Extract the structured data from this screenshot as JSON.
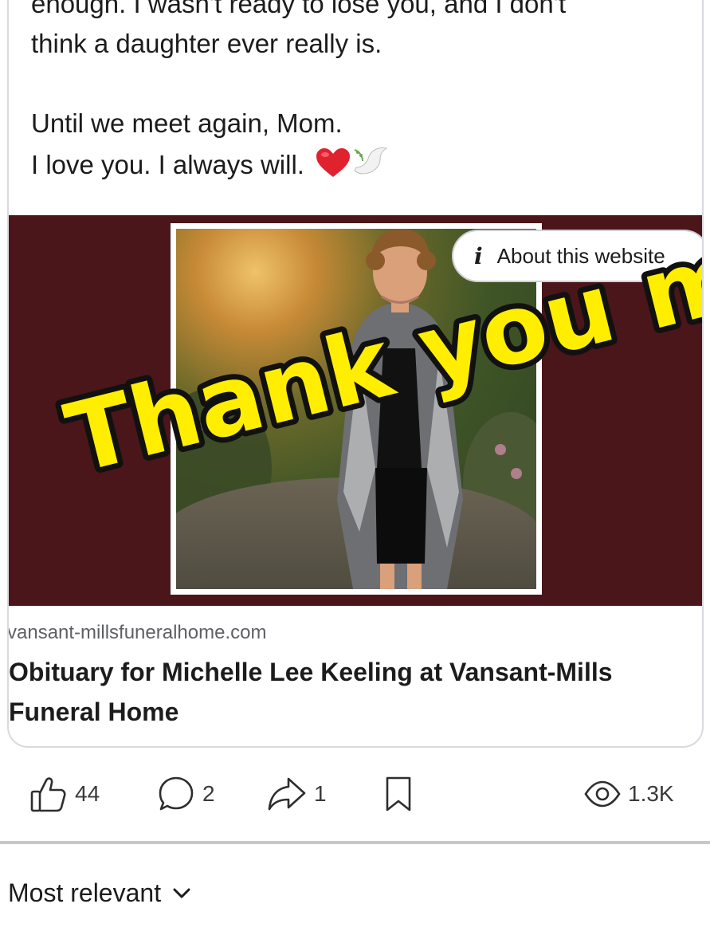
{
  "post": {
    "lines": [
      "enough. I wasn't ready to lose you, and I don't",
      "think a daughter ever really is.",
      "Until we meet again, Mom.",
      "I love you. I always will."
    ]
  },
  "media": {
    "about_label": "About this website",
    "overlay_text": "Thank you mom",
    "colors": {
      "backdrop": "#4a1619",
      "overlay_fill": "#ffee00",
      "overlay_stroke": "#111111"
    }
  },
  "link": {
    "domain": "vansant-millsfuneralhome.com",
    "title_lines": [
      "Obituary for Michelle Lee Keeling at Vansant-Mills",
      "Funeral Home"
    ]
  },
  "actions": {
    "likes": "44",
    "comments": "2",
    "shares": "1",
    "views": "1.3K",
    "icons": [
      "thumbs-up-icon",
      "comment-icon",
      "share-icon",
      "bookmark-icon",
      "eye-icon"
    ]
  },
  "comments": {
    "sort_label": "Most relevant"
  }
}
